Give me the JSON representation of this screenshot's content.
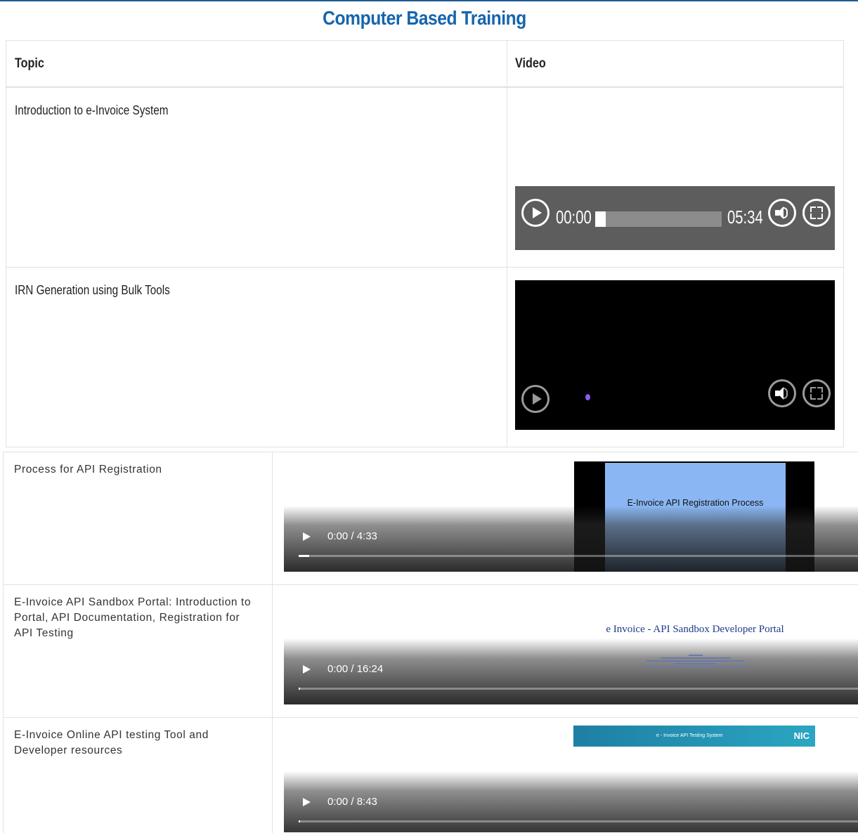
{
  "page": {
    "title": "Computer Based Training"
  },
  "table1": {
    "headers": {
      "topic": "Topic",
      "video": "Video"
    },
    "rows": [
      {
        "topic": "Introduction to e-Invoice System",
        "player": {
          "current_time": "00:00",
          "duration": "05:34"
        }
      },
      {
        "topic": "IRN Generation using Bulk Tools",
        "player": {
          "state": "loading"
        }
      }
    ]
  },
  "table2": {
    "rows": [
      {
        "topic": "Process for API Registration",
        "video": {
          "time": "0:00 / 4:33",
          "thumbnail_text": "E-Invoice API Registration Process"
        }
      },
      {
        "topic": "E-Invoice API Sandbox Portal: Introduction to Portal, API Documentation, Registration for API Testing",
        "video": {
          "time": "0:00 / 16:24",
          "thumbnail_text": "e Invoice - API Sandbox Developer Portal"
        }
      },
      {
        "topic": "E-Invoice Online API testing Tool and Developer resources",
        "video": {
          "time": "0:00 / 8:43",
          "thumbnail_text": "e - Invoice API Testing System",
          "thumbnail_logo": "NIC"
        }
      }
    ]
  },
  "colors": {
    "title": "#1565ad",
    "player_bg": "#5d5d5d",
    "border": "#e2e2e2",
    "thumb_blue": "#8ab7f3",
    "loading_dot": "#8a5cf5"
  }
}
